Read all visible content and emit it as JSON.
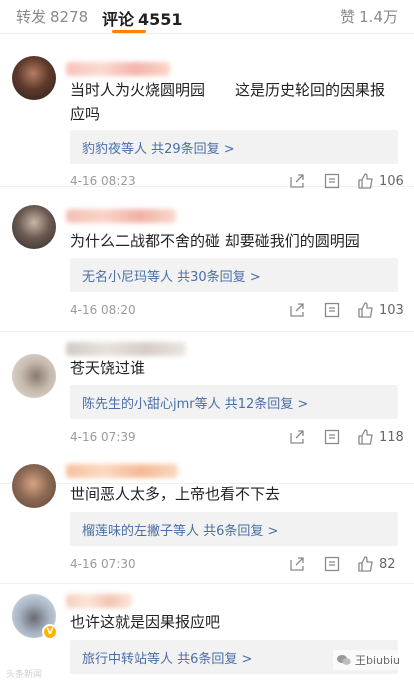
{
  "tabs": {
    "repost": {
      "label": "转发",
      "count": "8278"
    },
    "comment": {
      "label": "评论",
      "count": "4551"
    },
    "like": {
      "label": "赞",
      "count": "1.4万"
    }
  },
  "comments": [
    {
      "text": "当时人为火烧圆明园　　这是历史轮回的因果报应吗",
      "reply": "豹豹夜等人  共29条回复 >",
      "time": "4-16 08:23",
      "likes": "106"
    },
    {
      "text": "为什么二战都不舍的碰 却要碰我们的圆明园",
      "reply": "无名小尼玛等人  共30条回复 >",
      "time": "4-16 08:20",
      "likes": "103"
    },
    {
      "text": "苍天饶过谁",
      "reply": "陈先生的小甜心jmr等人  共12条回复 >",
      "time": "4-16 07:39",
      "likes": "118"
    },
    {
      "text": "世间恶人太多，上帝也看不下去",
      "reply": "榴莲味的左撇子等人  共6条回复 >",
      "time": "4-16 07:30",
      "likes": "82"
    },
    {
      "text": "也许这就是因果报应吧",
      "reply": "旅行中转站等人  共6条回复 >",
      "time": "",
      "likes": ""
    }
  ],
  "watermark": {
    "left": "头条新闻",
    "right": "王biubiu"
  },
  "colors": {
    "accent": "#ff8200",
    "link": "#4a6ea8",
    "reply_bg": "#f2f2f2"
  },
  "icons": [
    "share-icon",
    "comment-icon",
    "like-icon",
    "vip-badge-icon",
    "wechat-icon"
  ]
}
